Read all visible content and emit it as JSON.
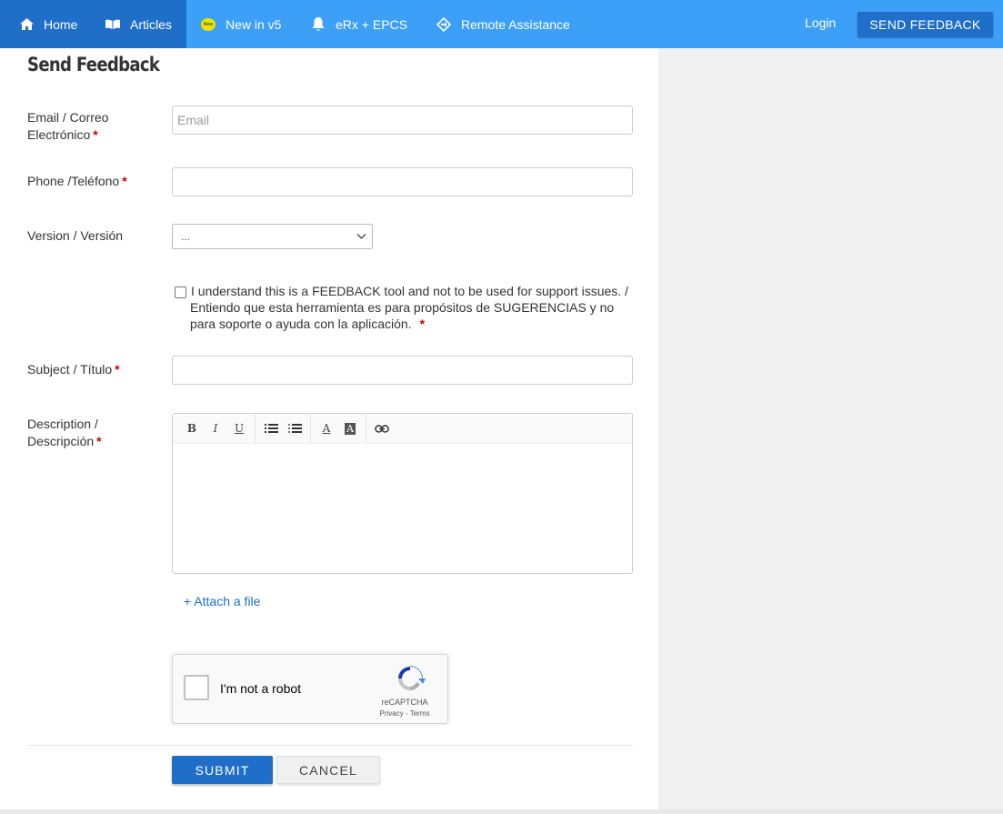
{
  "nav": {
    "items": [
      {
        "label": "Home",
        "icon": "home-icon"
      },
      {
        "label": "Articles",
        "icon": "book-icon"
      },
      {
        "label": "New in v5",
        "icon": "new-badge-icon",
        "badge": "New"
      },
      {
        "label": "eRx + EPCS",
        "icon": "bell-icon"
      },
      {
        "label": "Remote Assistance",
        "icon": "diamond-arrow-icon"
      }
    ],
    "login": "Login",
    "send_feedback": "SEND FEEDBACK"
  },
  "form": {
    "title": "Send Feedback",
    "email": {
      "label_line1": "Email / Correo",
      "label_line2": "Electrónico",
      "placeholder": "Email",
      "value": ""
    },
    "phone": {
      "label": "Phone /Teléfono",
      "value": ""
    },
    "version": {
      "label": "Version / Versión",
      "selected": "..."
    },
    "ack": {
      "line1": "I understand this is a FEEDBACK tool and not to be used for support issues. /",
      "line2": "Entiendo que esta herramienta es para propósitos de SUGERENCIAS y no",
      "line3": "para soporte o ayuda con la aplicación.",
      "checked": false
    },
    "subject": {
      "label": "Subject / Título",
      "value": ""
    },
    "description": {
      "label_line1": "Description /",
      "label_line2": "Descripción",
      "value": ""
    },
    "required_mark": "*",
    "toolbar": {
      "bold": "B",
      "italic": "I",
      "underline": "U",
      "font_color": "A",
      "bg_color": "A"
    },
    "attach": "+ Attach a file",
    "recaptcha": {
      "label": "I'm not a robot",
      "brand": "reCAPTCHA",
      "links": "Privacy - Terms"
    },
    "submit": "SUBMIT",
    "cancel": "CANCEL"
  },
  "colors": {
    "nav": "#3ca0f8",
    "nav_active": "#1f6fc9",
    "primary": "#1f6fc9",
    "required": "#cc0000"
  }
}
